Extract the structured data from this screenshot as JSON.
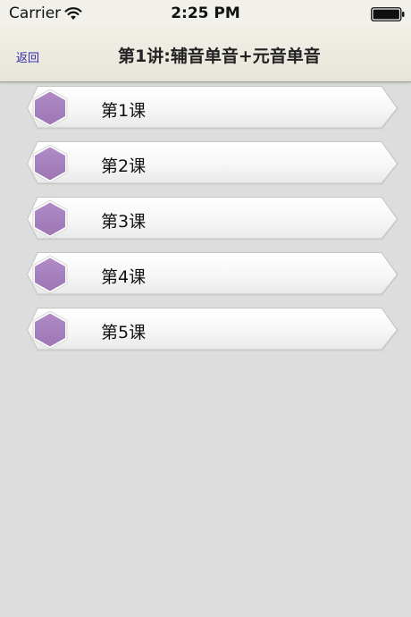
{
  "status_bar": {
    "carrier": "Carrier",
    "time": "2:25 PM",
    "wifi_icon": "wifi-icon",
    "battery_icon": "battery-icon"
  },
  "nav": {
    "back_label": "返回",
    "title": "第1讲:辅音单音+元音单音"
  },
  "lessons": [
    {
      "label": "第1课"
    },
    {
      "label": "第2课"
    },
    {
      "label": "第3课"
    },
    {
      "label": "第4课"
    },
    {
      "label": "第5课"
    }
  ],
  "colors": {
    "background": "#dcdddc",
    "hexagon": "#a77fbd",
    "back_link": "#2d2aa8"
  }
}
